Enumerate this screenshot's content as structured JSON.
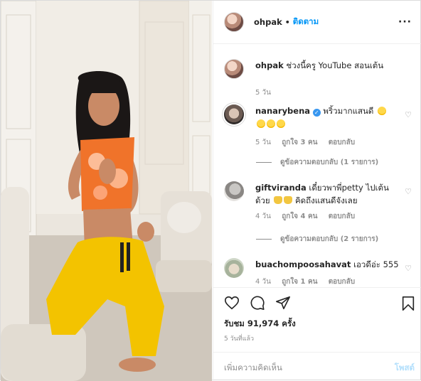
{
  "header": {
    "username": "ohpak",
    "separator": "•",
    "follow_label": "ติดตาม",
    "more_icon": "more-horizontal-icon"
  },
  "caption": {
    "username": "ohpak",
    "text": "ช่วงนี้ครู YouTube สอนเต้น",
    "time": "5 วัน"
  },
  "comments": [
    {
      "username": "nanarybena",
      "verified": true,
      "text": "พริ้วมากแสนดี",
      "time": "5 วัน",
      "likes": "ถูกใจ 3 คน",
      "reply": "ตอบกลับ",
      "view_replies": "ดูข้อความตอบกลับ (1 รายการ)"
    },
    {
      "username": "giftviranda",
      "text": "เดี๋ยวพาพี่petty ไปเต้นด้วย",
      "text_tail": "คิดถึงแสนดีจังเลย",
      "time": "4 วัน",
      "likes": "ถูกใจ 4 คน",
      "reply": "ตอบกลับ",
      "view_replies": "ดูข้อความตอบกลับ (2 รายการ)"
    },
    {
      "username": "buachompoosahavat",
      "text": "เอวดีอ่ะ 555",
      "time": "4 วัน",
      "likes": "ถูกใจ 1 คน",
      "reply": "ตอบกลับ"
    }
  ],
  "actions": {
    "icons": [
      "heart-icon",
      "comment-icon",
      "share-icon",
      "bookmark-icon"
    ],
    "views": "รับชม 91,974 ครั้ง",
    "posted_ago": "5 วันที่แล้ว"
  },
  "add_comment": {
    "placeholder": "เพิ่มความคิดเห็น",
    "post_label": "โพสต์"
  },
  "colors": {
    "link_blue": "#0095f6",
    "muted": "#8e8e8e",
    "shirt_orange": "#f0732a",
    "pants_yellow": "#f3c300"
  }
}
